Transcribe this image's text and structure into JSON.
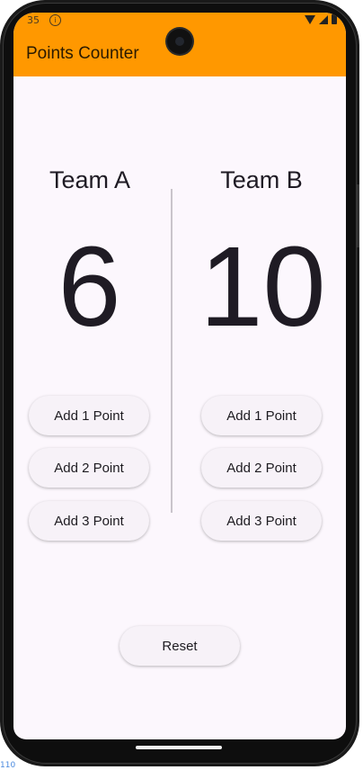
{
  "status_bar": {
    "time": "35",
    "info_icon": "info-icon",
    "icons": [
      "wifi-icon",
      "signal-icon",
      "battery-icon"
    ]
  },
  "app": {
    "title": "Points Counter",
    "accent_color": "#ff9800"
  },
  "teams": [
    {
      "name": "Team A",
      "score": "6",
      "buttons": [
        "Add 1 Point",
        "Add 2 Point",
        "Add 3 Point"
      ]
    },
    {
      "name": "Team B",
      "score": "10",
      "buttons": [
        "Add 1 Point",
        "Add 2 Point",
        "Add 3 Point"
      ]
    }
  ],
  "reset_label": "Reset",
  "corner_label": "110"
}
